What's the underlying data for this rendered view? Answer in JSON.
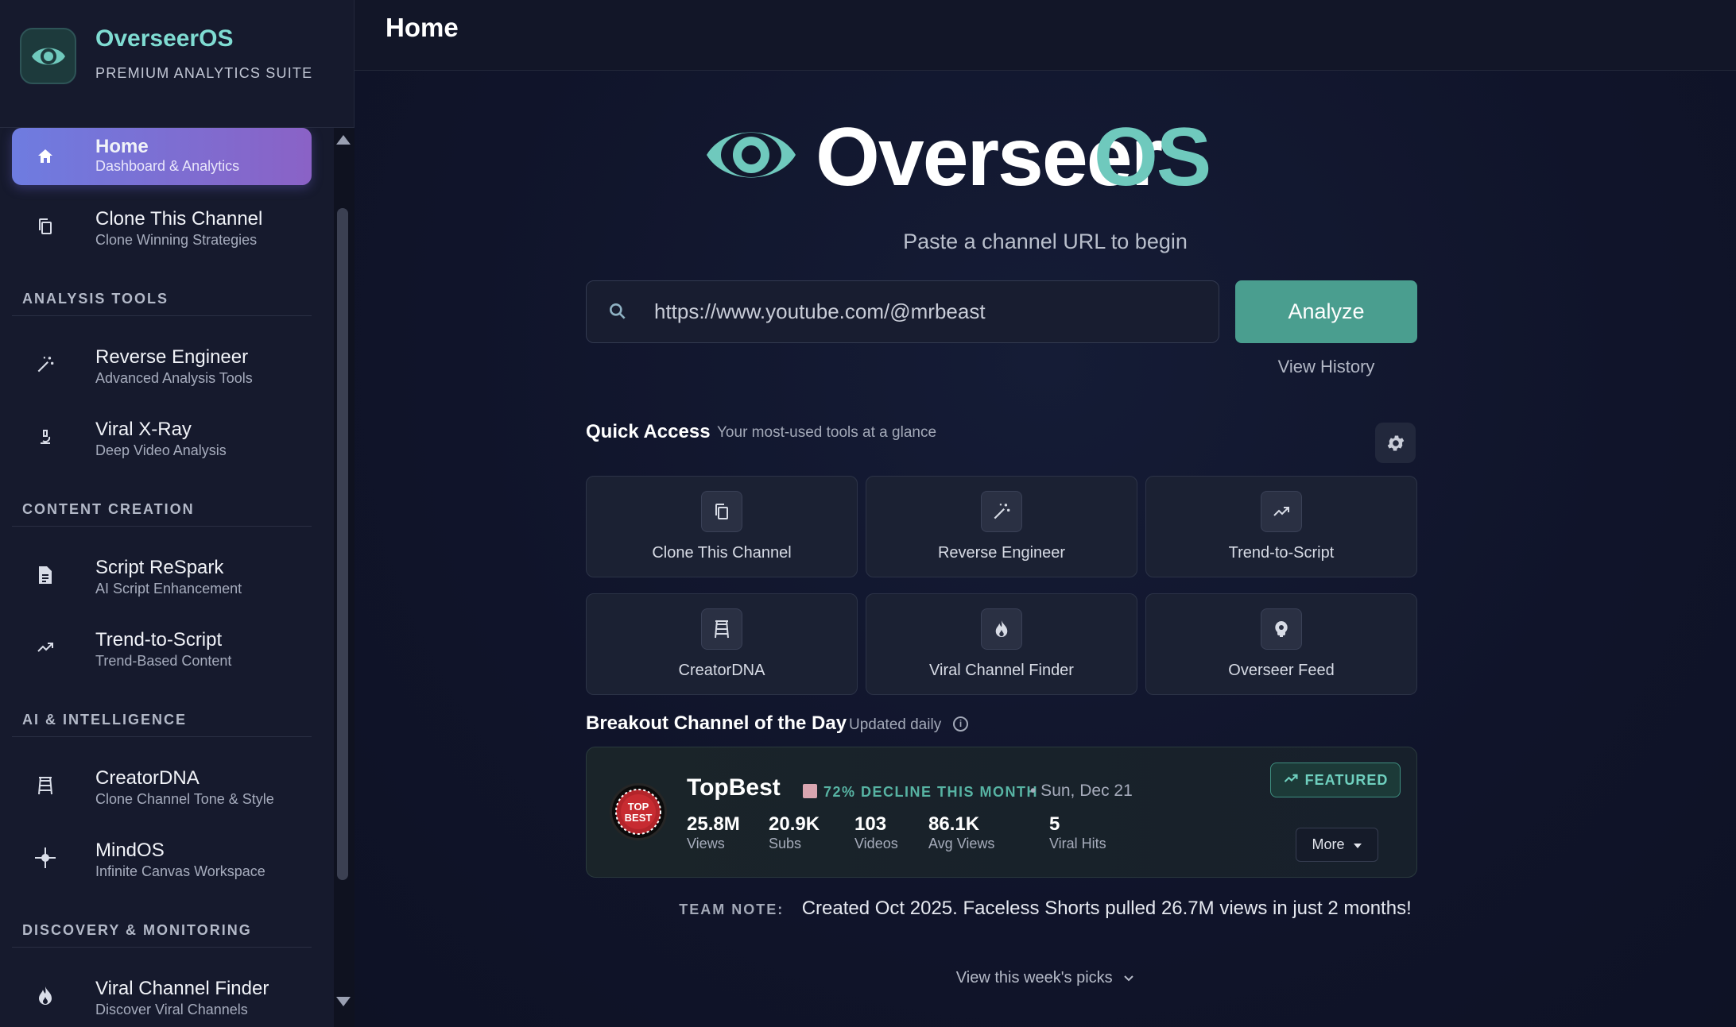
{
  "brand": {
    "name": "OverseerOS",
    "subtitle": "PREMIUM ANALYTICS SUITE"
  },
  "sidebar": {
    "items": [
      {
        "label": "Home",
        "desc": "Dashboard & Analytics",
        "icon": "home-icon",
        "active": true
      },
      {
        "label": "Clone This Channel",
        "desc": "Clone Winning Strategies",
        "icon": "copy-icon"
      },
      {
        "label": "Reverse Engineer",
        "desc": "Advanced Analysis Tools",
        "icon": "magic-wand-icon"
      },
      {
        "label": "Viral X-Ray",
        "desc": "Deep Video Analysis",
        "icon": "microscope-icon"
      },
      {
        "label": "Script ReSpark",
        "desc": "AI Script Enhancement",
        "icon": "document-icon"
      },
      {
        "label": "Trend-to-Script",
        "desc": "Trend-Based Content",
        "icon": "trending-up-icon"
      },
      {
        "label": "CreatorDNA",
        "desc": "Clone Channel Tone & Style",
        "icon": "ladder-icon"
      },
      {
        "label": "MindOS",
        "desc": "Infinite Canvas Workspace",
        "icon": "crosshair-icon"
      },
      {
        "label": "Viral Channel Finder",
        "desc": "Discover Viral Channels",
        "icon": "flame-icon"
      }
    ],
    "sections": [
      "ANALYSIS TOOLS",
      "CONTENT CREATION",
      "AI & INTELLIGENCE",
      "DISCOVERY & MONITORING"
    ]
  },
  "header": {
    "title": "Home"
  },
  "hero": {
    "word1": "Overseer",
    "word2": "OS",
    "tagline": "Paste a channel URL to begin"
  },
  "search": {
    "value": "https://www.youtube.com/@mrbeast",
    "button": "Analyze",
    "history": "View History"
  },
  "quick_access": {
    "title": "Quick Access",
    "subtitle": "Your most-used tools at a glance",
    "cards": [
      {
        "label": "Clone This Channel",
        "icon": "copy-icon"
      },
      {
        "label": "Reverse Engineer",
        "icon": "magic-wand-icon"
      },
      {
        "label": "Trend-to-Script",
        "icon": "trending-up-icon"
      },
      {
        "label": "CreatorDNA",
        "icon": "ladder-icon"
      },
      {
        "label": "Viral Channel Finder",
        "icon": "flame-icon"
      },
      {
        "label": "Overseer Feed",
        "icon": "lightbulb-head-icon"
      }
    ]
  },
  "breakout": {
    "title": "Breakout Channel of the Day",
    "subtitle": "Updated daily",
    "info": "i",
    "channel": "TopBest",
    "avatar_text": "TOP BEST",
    "trend": "72% DECLINE THIS MONTH",
    "date": "• Sun, Dec 21",
    "featured": "FEATURED",
    "more": "More",
    "stats": [
      {
        "value": "25.8M",
        "label": "Views"
      },
      {
        "value": "20.9K",
        "label": "Subs"
      },
      {
        "value": "103",
        "label": "Videos"
      },
      {
        "value": "86.1K",
        "label": "Avg Views"
      },
      {
        "value": "5",
        "label": "Viral Hits"
      }
    ]
  },
  "team_note": {
    "label": "TEAM NOTE:",
    "text": "Created Oct 2025. Faceless Shorts pulled 26.7M views in just 2 months!"
  },
  "week_picks": "View this week's picks",
  "colors": {
    "accent": "#4a9e8f",
    "brand_teal": "#6fc9bd",
    "active_from": "#6e7ce0",
    "active_to": "#8a62c6"
  }
}
